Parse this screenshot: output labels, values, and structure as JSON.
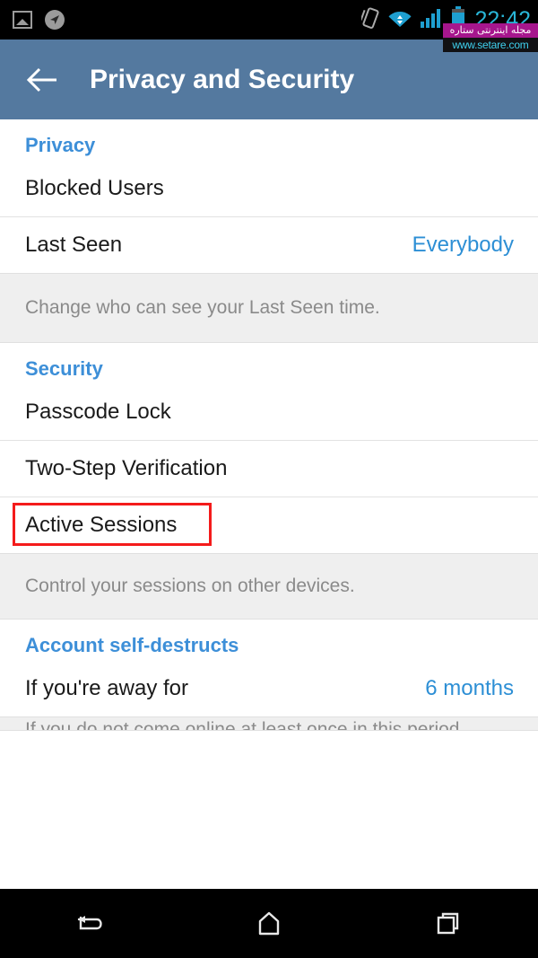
{
  "status_bar": {
    "time": "22:42",
    "left_icons": [
      {
        "name": "gallery-icon",
        "glyph": "image"
      },
      {
        "name": "location-icon",
        "glyph": "navigation-arrow"
      }
    ],
    "right_icons": [
      {
        "name": "rotation-lock-icon",
        "glyph": "phone-rotate"
      },
      {
        "name": "wifi-icon",
        "glyph": "wifi"
      },
      {
        "name": "cellular-signal-icon",
        "glyph": "signal-bars"
      },
      {
        "name": "battery-icon",
        "glyph": "battery"
      }
    ],
    "colors": {
      "background": "#000000",
      "clock": "#29b6d8",
      "icon_accent": "#29a8d8",
      "icon_gray": "#9b9b9b"
    }
  },
  "watermark": {
    "banner_text": "مجله اینترنتی ستاره",
    "url_text": "www.setare.com",
    "banner_color": "#a6168d",
    "url_color": "#3fd0ee"
  },
  "header": {
    "back_label": "←",
    "title": "Privacy and Security",
    "background_color": "#54799f",
    "text_color": "#ffffff"
  },
  "colors": {
    "accent_blue": "#3d8fd8",
    "value_blue": "#2d8fd5",
    "note_background": "#efefef",
    "note_text": "#8a8a8a",
    "row_text": "#1a1a1a",
    "highlight_red": "#f41b1b",
    "divider": "#e2e2e2"
  },
  "sections": [
    {
      "title": "Privacy",
      "rows": [
        {
          "label": "Blocked Users",
          "value": ""
        },
        {
          "label": "Last Seen",
          "value": "Everybody"
        }
      ],
      "note": "Change who can see your Last Seen time."
    },
    {
      "title": "Security",
      "rows": [
        {
          "label": "Passcode Lock",
          "value": ""
        },
        {
          "label": "Two-Step Verification",
          "value": ""
        },
        {
          "label": "Active Sessions",
          "value": "",
          "highlighted": true
        }
      ],
      "note": "Control your sessions on other devices."
    },
    {
      "title": "Account self-destructs",
      "rows": [
        {
          "label": "If you're away for",
          "value": "6 months"
        }
      ],
      "note": "If you do not come online at least once in this period."
    }
  ],
  "nav_bar": {
    "buttons": [
      {
        "name": "nav-back-button",
        "glyph": "back-arrow"
      },
      {
        "name": "nav-home-button",
        "glyph": "home"
      },
      {
        "name": "nav-recents-button",
        "glyph": "recents"
      }
    ]
  }
}
